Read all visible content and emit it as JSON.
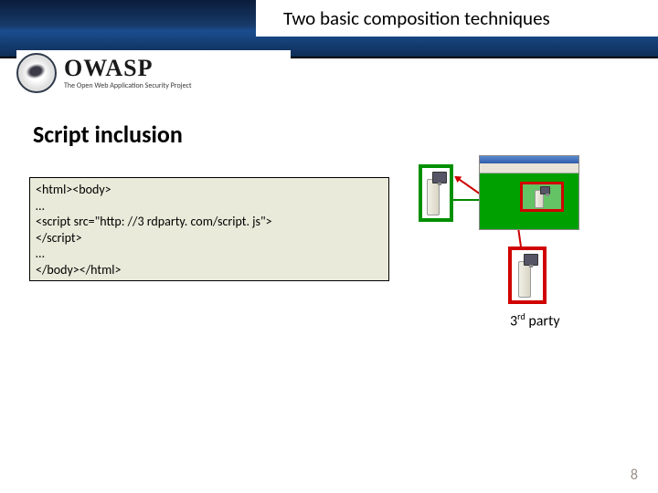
{
  "slide": {
    "title": "Two basic composition techniques",
    "section_heading": "Script inclusion",
    "page_number": "8"
  },
  "logo": {
    "main": "OWASP",
    "tagline": "The Open Web Application Security Project"
  },
  "code": {
    "line1": "<html><body>",
    "line2": "…",
    "line3": "<script src=\"http: //3 rdparty. com/script. js\">",
    "line4": "</script>",
    "line5": "…",
    "line6": "</body></html>"
  },
  "diagram": {
    "third_party_prefix": "3",
    "third_party_super": "rd",
    "third_party_suffix": " party"
  }
}
